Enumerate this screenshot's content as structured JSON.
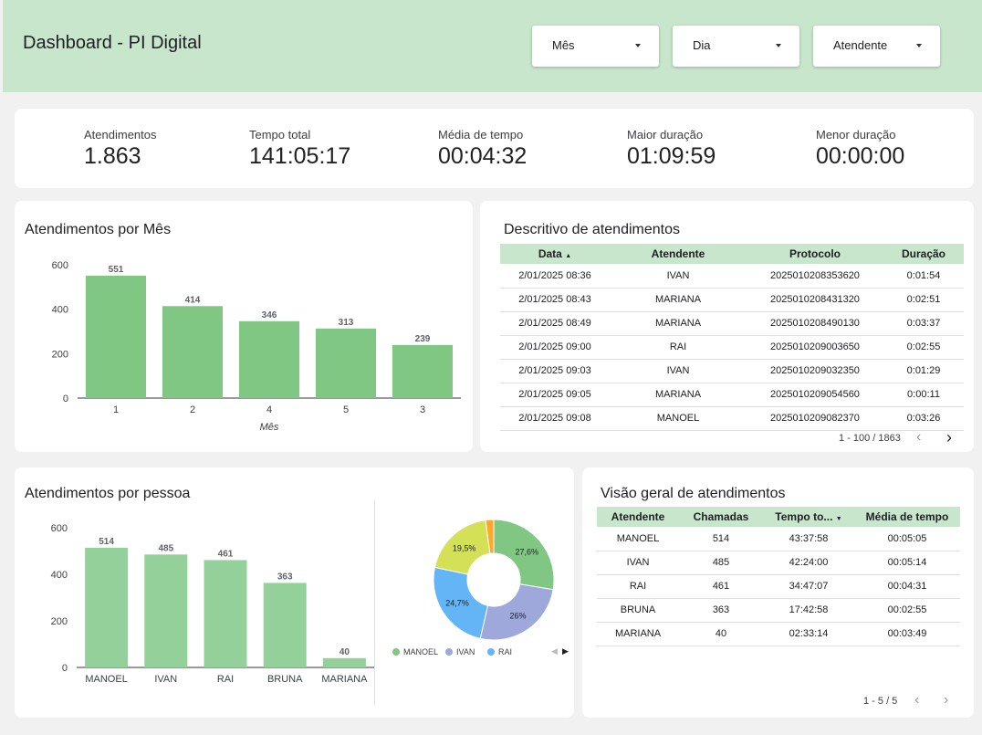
{
  "header": {
    "title": "Dashboard - PI Digital",
    "filters": [
      {
        "label": "Mês"
      },
      {
        "label": "Dia"
      },
      {
        "label": "Atendente"
      }
    ]
  },
  "kpis": [
    {
      "label": "Atendimentos",
      "value": "1.863"
    },
    {
      "label": "Tempo total",
      "value": "141:05:17"
    },
    {
      "label": "Média de tempo",
      "value": "00:04:32"
    },
    {
      "label": "Maior duração",
      "value": "01:09:59"
    },
    {
      "label": "Menor duração",
      "value": "00:00:00"
    }
  ],
  "month_chart": {
    "title": "Atendimentos por Mês"
  },
  "person_chart": {
    "title": "Atendimentos por pessoa"
  },
  "detail_table": {
    "title": "Descritivo de atendimentos",
    "columns": [
      "Data",
      "Atendente",
      "Protocolo",
      "Duração"
    ],
    "rows": [
      [
        "2/01/2025 08:36",
        "IVAN",
        "2025010208353620",
        "0:01:54"
      ],
      [
        "2/01/2025 08:43",
        "MARIANA",
        "2025010208431320",
        "0:02:51"
      ],
      [
        "2/01/2025 08:49",
        "MARIANA",
        "2025010208490130",
        "0:03:37"
      ],
      [
        "2/01/2025 09:00",
        "RAI",
        "2025010209003650",
        "0:02:55"
      ],
      [
        "2/01/2025 09:03",
        "IVAN",
        "2025010209032350",
        "0:01:29"
      ],
      [
        "2/01/2025 09:05",
        "MARIANA",
        "2025010209054560",
        "0:00:11"
      ],
      [
        "2/01/2025 09:08",
        "MANOEL",
        "2025010209082370",
        "0:03:26"
      ]
    ],
    "pager": "1 - 100 / 1863"
  },
  "overview_table": {
    "title": "Visão geral de atendimentos",
    "columns": [
      "Atendente",
      "Chamadas",
      "Tempo to...",
      "Média de tempo"
    ],
    "rows": [
      [
        "MANOEL",
        "514",
        "43:37:58",
        "00:05:05"
      ],
      [
        "IVAN",
        "485",
        "42:24:00",
        "00:05:14"
      ],
      [
        "RAI",
        "461",
        "34:47:07",
        "00:04:31"
      ],
      [
        "BRUNA",
        "363",
        "17:42:58",
        "00:02:55"
      ],
      [
        "MARIANA",
        "40",
        "02:33:14",
        "00:03:49"
      ]
    ],
    "pager": "1 - 5 / 5"
  },
  "chart_data": [
    {
      "type": "bar",
      "title": "Atendimentos por Mês",
      "categories": [
        "1",
        "2",
        "4",
        "5",
        "3"
      ],
      "values": [
        551,
        414,
        346,
        313,
        239
      ],
      "xlabel": "Mês",
      "ylabel": "",
      "ylim": [
        0,
        600
      ],
      "yticks": [
        0,
        200,
        400,
        600
      ],
      "color": "#81c784"
    },
    {
      "type": "bar",
      "title": "Atendimentos por pessoa",
      "categories": [
        "MANOEL",
        "IVAN",
        "RAI",
        "BRUNA",
        "MARIANA"
      ],
      "values": [
        514,
        485,
        461,
        363,
        40
      ],
      "xlabel": "",
      "ylabel": "",
      "ylim": [
        0,
        600
      ],
      "yticks": [
        0,
        200,
        400,
        600
      ],
      "color": "#94d19a"
    },
    {
      "type": "pie",
      "slices": [
        {
          "name": "MANOEL",
          "value": 27.6,
          "label": "27,6%",
          "color": "#81c784"
        },
        {
          "name": "IVAN",
          "value": 26,
          "label": "26%",
          "color": "#9fa8da"
        },
        {
          "name": "RAI",
          "value": 24.7,
          "label": "24,7%",
          "color": "#64b5f6"
        },
        {
          "name": "BRUNA",
          "value": 19.5,
          "label": "19,5%",
          "color": "#d4e157"
        },
        {
          "name": "MARIANA",
          "value": 2.2,
          "label": "",
          "color": "#ffa726"
        }
      ],
      "legend": [
        "MANOEL",
        "IVAN",
        "RAI"
      ],
      "legend_position": "bottom"
    }
  ]
}
